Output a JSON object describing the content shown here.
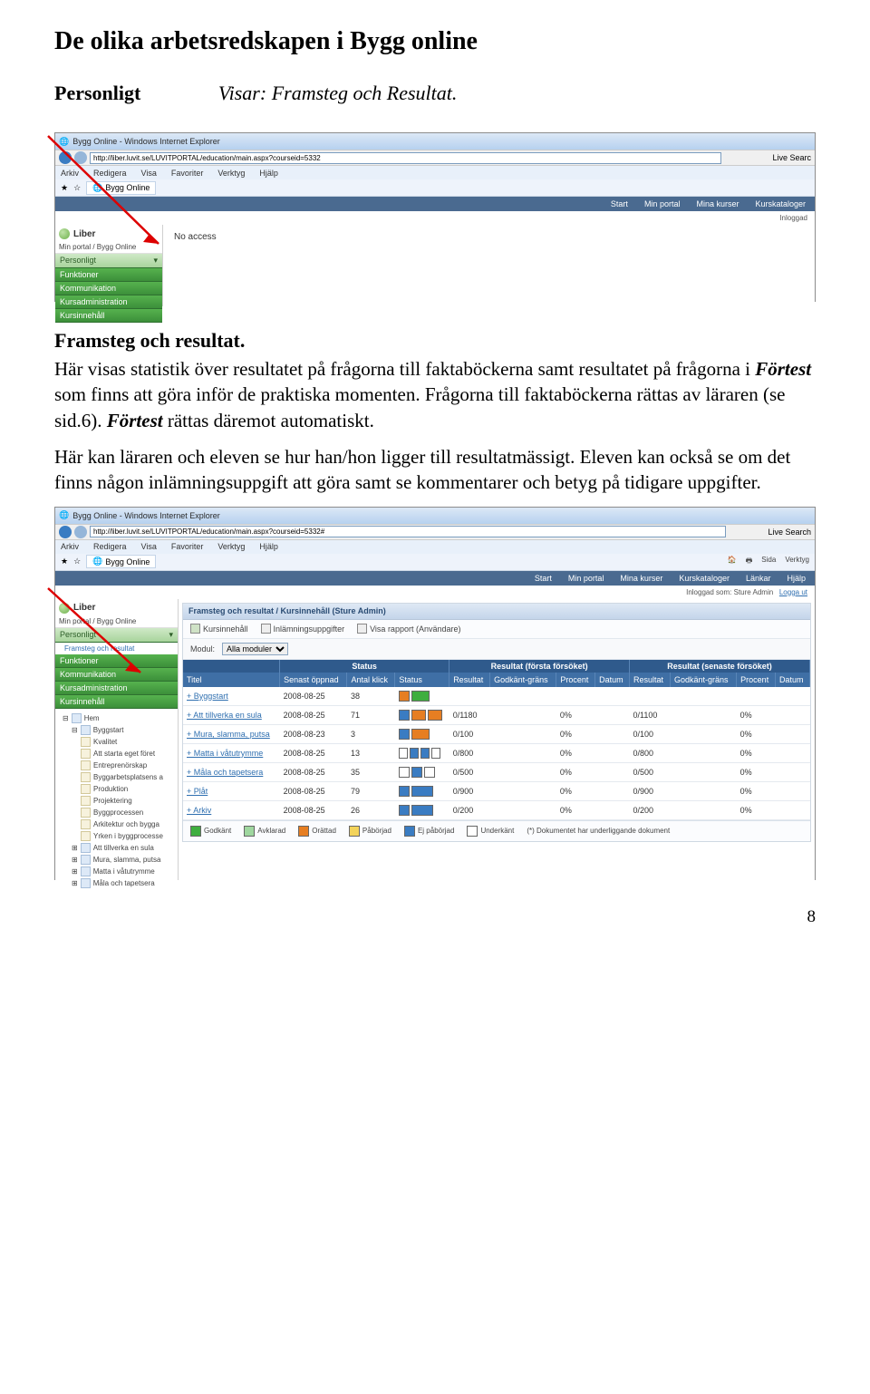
{
  "heading": "De olika arbetsredskapen i Bygg online",
  "subhead": {
    "label": "Personligt",
    "desc": "Visar: Framsteg och Resultat."
  },
  "ss1": {
    "title": "Bygg Online - Windows Internet Explorer",
    "url": "http://liber.luvit.se/LUVITPORTAL/education/main.aspx?courseid=5332",
    "search": "Live Searc",
    "menus": [
      "Arkiv",
      "Redigera",
      "Visa",
      "Favoriter",
      "Verktyg",
      "Hjälp"
    ],
    "fav": "Bygg Online",
    "tabs": [
      "Start",
      "Min portal",
      "Mina kurser",
      "Kurskataloger"
    ],
    "logo": "Liber",
    "crumb": "Min portal / Bygg Online",
    "status": "Inloggad",
    "sidemenu": [
      "Personligt",
      "Funktioner",
      "Kommunikation",
      "Kursadministration",
      "Kursinnehåll"
    ],
    "main": "No access"
  },
  "section2_title": "Framsteg och resultat.",
  "para1_a": "Här visas statistik över resultatet på frågorna till",
  "para1_b": "faktaböckerna samt resultatet på frågorna i ",
  "para1_c": "Förtest",
  "para1_d": " som finns att göra inför de praktiska momenten. Frågorna till faktaböckerna rättas av läraren (se sid.6). ",
  "para1_e": "Förtest",
  "para1_f": " rättas däremot automatiskt.",
  "para2": "Här kan läraren och eleven se hur han/hon ligger till resultatmässigt. Eleven kan också se om det finns någon inlämningsuppgift att göra samt se kommentarer och betyg på tidigare uppgifter.",
  "ss2": {
    "title": "Bygg Online - Windows Internet Explorer",
    "url": "http://liber.luvit.se/LUVITPORTAL/education/main.aspx?courseid=5332#",
    "search": "Live Search",
    "menus": [
      "Arkiv",
      "Redigera",
      "Visa",
      "Favoriter",
      "Verktyg",
      "Hjälp"
    ],
    "fav": "Bygg Online",
    "tools": [
      "Sida",
      "Verktyg"
    ],
    "tabs": [
      "Start",
      "Min portal",
      "Mina kurser",
      "Kurskataloger",
      "Länkar",
      "Hjälp"
    ],
    "logo": "Liber",
    "crumb": "Min portal / Bygg Online",
    "status_prefix": "Inloggad som:",
    "status_user": "Sture Admin",
    "logout": "Logga ut",
    "side": {
      "top": "Personligt",
      "sub": "Framsteg och resultat",
      "items": [
        "Funktioner",
        "Kommunikation",
        "Kursadministration",
        "Kursinnehåll"
      ]
    },
    "tree": {
      "root": "Hem",
      "items": [
        "Byggstart",
        "Kvalitet",
        "Att starta eget föret",
        "Entreprenörskap",
        "Byggarbetsplatsens a",
        "Produktion",
        "Projektering",
        "Byggprocessen",
        "Arkitektur och bygga",
        "Yrken i byggprocesse",
        "Att tillverka en sula",
        "Mura, slamma, putsa",
        "Matta i våtutrymme",
        "Måla och tapetsera"
      ]
    },
    "panel": {
      "title": "Framsteg och resultat / Kursinnehåll (Sture Admin)",
      "subtabs": [
        "Kursinnehåll",
        "Inlämningsuppgifter",
        "Visa rapport (Användare)"
      ],
      "module_label": "Modul:",
      "module_value": "Alla moduler",
      "group_headers": [
        "",
        "Status",
        "Resultat (första försöket)",
        "Resultat (senaste försöket)"
      ],
      "cols": [
        "Titel",
        "Senast öppnad",
        "Antal klick",
        "Status",
        "Resultat",
        "Godkänt-gräns",
        "Procent",
        "Datum",
        "Resultat",
        "Godkänt-gräns",
        "Procent",
        "Datum"
      ],
      "rows": [
        {
          "title": "+ Byggstart",
          "date": "2008-08-25",
          "clicks": "38",
          "status": [
            [
              "s-orange",
              10
            ],
            [
              "s-green",
              18
            ]
          ],
          "r1": "",
          "g1": "",
          "p1": "",
          "d1": "",
          "r2": "",
          "g2": "",
          "p2": ""
        },
        {
          "title": "+ Att tillverka en sula",
          "date": "2008-08-25",
          "clicks": "71",
          "status": [
            [
              "s-blue",
              10
            ],
            [
              "s-orange",
              14
            ],
            [
              "s-orange",
              14
            ]
          ],
          "r1": "0/1180",
          "g1": "",
          "p1": "0%",
          "d1": "",
          "r2": "0/1100",
          "g2": "",
          "p2": "0%"
        },
        {
          "title": "+ Mura, slamma, putsa",
          "date": "2008-08-23",
          "clicks": "3",
          "status": [
            [
              "s-blue",
              10
            ],
            [
              "s-orange",
              18
            ]
          ],
          "r1": "0/100",
          "g1": "",
          "p1": "0%",
          "d1": "",
          "r2": "0/100",
          "g2": "",
          "p2": "0%"
        },
        {
          "title": "+ Matta i våtutrymme",
          "date": "2008-08-25",
          "clicks": "13",
          "status": [
            [
              "s-white",
              8
            ],
            [
              "s-blue",
              8
            ],
            [
              "s-blue",
              8
            ],
            [
              "s-white",
              8
            ]
          ],
          "r1": "0/800",
          "g1": "",
          "p1": "0%",
          "d1": "",
          "r2": "0/800",
          "g2": "",
          "p2": "0%"
        },
        {
          "title": "+ Måla och tapetsera",
          "date": "2008-08-25",
          "clicks": "35",
          "status": [
            [
              "s-white",
              10
            ],
            [
              "s-blue",
              10
            ],
            [
              "s-white",
              10
            ]
          ],
          "r1": "0/500",
          "g1": "",
          "p1": "0%",
          "d1": "",
          "r2": "0/500",
          "g2": "",
          "p2": "0%"
        },
        {
          "title": "+ Plåt",
          "date": "2008-08-25",
          "clicks": "79",
          "status": [
            [
              "s-blue",
              10
            ],
            [
              "s-blue",
              22
            ]
          ],
          "r1": "0/900",
          "g1": "",
          "p1": "0%",
          "d1": "",
          "r2": "0/900",
          "g2": "",
          "p2": "0%"
        },
        {
          "title": "+ Arkiv",
          "date": "2008-08-25",
          "clicks": "26",
          "status": [
            [
              "s-blue",
              10
            ],
            [
              "s-blue",
              22
            ]
          ],
          "r1": "0/200",
          "g1": "",
          "p1": "0%",
          "d1": "",
          "r2": "0/200",
          "g2": "",
          "p2": "0%"
        }
      ],
      "legend": [
        {
          "color": "#3fae3f",
          "label": "Godkänt"
        },
        {
          "color": "#9fd79f",
          "label": "Avklarad"
        },
        {
          "color": "#e67e22",
          "label": "Orättad"
        },
        {
          "color": "#f3d35a",
          "label": "Påbörjad"
        },
        {
          "color": "#3a7cc2",
          "label": "Ej påbörjad"
        },
        {
          "color": "#ffffff",
          "label": "Underkänt"
        }
      ],
      "legend_note": "(*)  Dokumentet har underliggande dokument"
    }
  },
  "page_number": "8"
}
